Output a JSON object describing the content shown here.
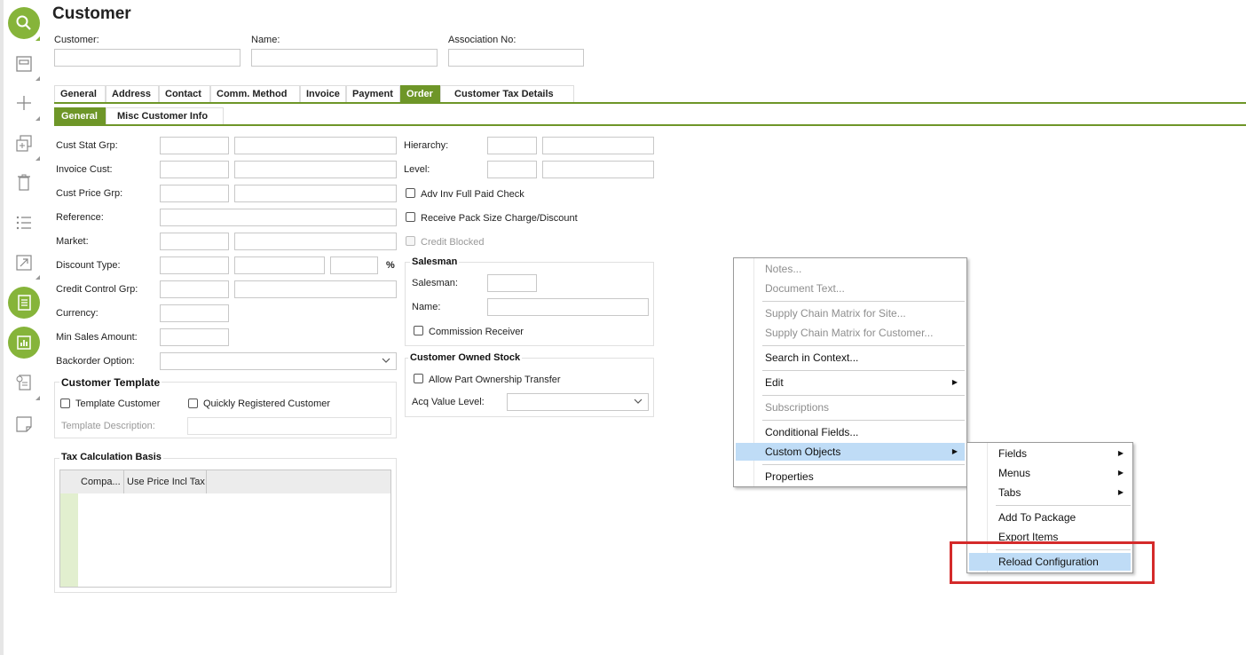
{
  "page": {
    "title": "Customer"
  },
  "header_fields": {
    "customer_label": "Customer:",
    "name_label": "Name:",
    "association_label": "Association No:"
  },
  "tabs": [
    "General",
    "Address",
    "Contact",
    "Comm. Method",
    "Invoice",
    "Payment",
    "Order",
    "Customer Tax Details"
  ],
  "active_tab": "Order",
  "subtabs": [
    "General",
    "Misc Customer Info"
  ],
  "active_subtab": "General",
  "left_fields": {
    "cust_stat_grp": "Cust Stat Grp:",
    "invoice_cust": "Invoice Cust:",
    "cust_price_grp": "Cust Price Grp:",
    "reference": "Reference:",
    "market": "Market:",
    "discount_type": "Discount Type:",
    "percent": "%",
    "credit_control_grp": "Credit Control Grp:",
    "currency": "Currency:",
    "min_sales_amount": "Min Sales Amount:",
    "backorder_option": "Backorder Option:"
  },
  "customer_template": {
    "title": "Customer Template",
    "template_customer": "Template Customer",
    "quickly_registered": "Quickly Registered Customer",
    "template_description": "Template Description:"
  },
  "tax_calc": {
    "title": "Tax Calculation Basis",
    "columns": [
      "Compa...",
      "Use Price Incl Tax"
    ]
  },
  "right_fields": {
    "hierarchy": "Hierarchy:",
    "level": "Level:",
    "adv_inv": "Adv Inv Full Paid Check",
    "receive_pack": "Receive Pack Size Charge/Discount",
    "credit_blocked": "Credit Blocked"
  },
  "salesman": {
    "title": "Salesman",
    "salesman_label": "Salesman:",
    "name_label": "Name:",
    "commission_receiver": "Commission Receiver"
  },
  "customer_owned_stock": {
    "title": "Customer Owned Stock",
    "allow_transfer": "Allow Part Ownership Transfer",
    "acq_value_level": "Acq Value Level:"
  },
  "context_menu": {
    "items": [
      {
        "label": "Notes...",
        "disabled": true
      },
      {
        "label": "Document Text...",
        "disabled": true
      },
      {
        "label": "Supply Chain Matrix for Site...",
        "disabled": true
      },
      {
        "label": "Supply Chain Matrix for Customer...",
        "disabled": true
      },
      {
        "label": "Search in Context...",
        "disabled": false
      },
      {
        "label": "Edit",
        "disabled": false,
        "submenu": true
      },
      {
        "label": "Subscriptions",
        "disabled": true
      },
      {
        "label": "Conditional Fields...",
        "disabled": false
      },
      {
        "label": "Custom Objects",
        "disabled": false,
        "submenu": true,
        "highlighted": true
      },
      {
        "label": "Properties",
        "disabled": false
      }
    ]
  },
  "submenu": {
    "items": [
      {
        "label": "Fields",
        "submenu": true
      },
      {
        "label": "Menus",
        "submenu": true
      },
      {
        "label": "Tabs",
        "submenu": true
      },
      {
        "label": "Add To Package"
      },
      {
        "label": "Export Items"
      },
      {
        "label": "Reload Configuration",
        "highlighted": true
      }
    ]
  },
  "sidebar_icons": [
    "search-icon",
    "save-icon",
    "add-icon",
    "duplicate-icon",
    "delete-icon",
    "list-icon",
    "navigate-icon",
    "details-list-icon",
    "chart-icon",
    "info-document-icon",
    "note-icon"
  ],
  "colors": {
    "accent": "#86b43a",
    "tab_active": "#6e9628",
    "menu_highlight": "#bfdcf6",
    "annotation": "#d42a2a"
  }
}
